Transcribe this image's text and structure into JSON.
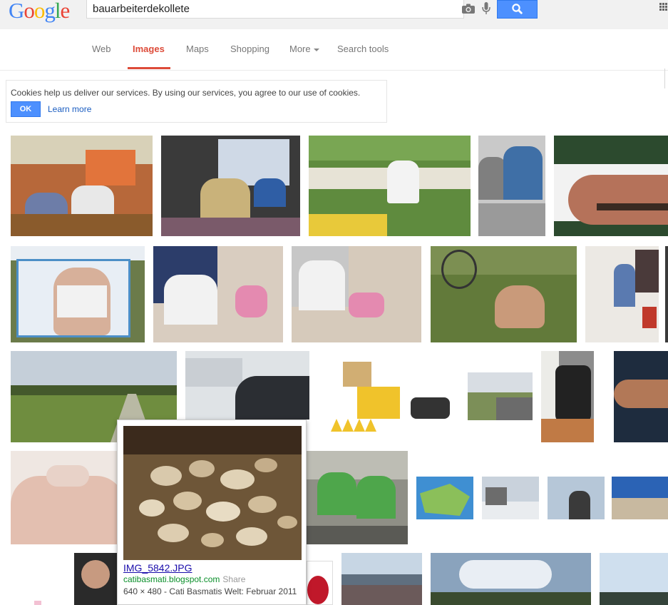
{
  "header": {
    "logo": {
      "l1": "G",
      "l2": "o",
      "l3": "o",
      "l4": "g",
      "l5": "l",
      "l6": "e"
    },
    "search_value": "bauarbeiterdekollete",
    "camera_icon": "camera-icon",
    "mic_icon": "microphone-icon",
    "search_icon": "magnifier-icon",
    "apps_icon": "apps-grid-icon"
  },
  "nav": {
    "tabs": [
      {
        "label": "Web"
      },
      {
        "label": "Images"
      },
      {
        "label": "Maps"
      },
      {
        "label": "Shopping"
      },
      {
        "label": "More"
      },
      {
        "label": "Search tools"
      }
    ],
    "active": "Images"
  },
  "cookie": {
    "text": "Cookies help us deliver our services. By using our services, you agree to our use of cookies.",
    "ok_label": "OK",
    "learn_more": "Learn more"
  },
  "hover_card": {
    "title": "IMG_5842.JPG",
    "source": "catibasmati.blogspot.com",
    "share": "Share",
    "description": "640 × 480 - Cati Basmatis Welt: Februar 2011"
  },
  "colors": {
    "accent_red": "#dd4b39",
    "search_blue": "#4d90fe",
    "link_blue": "#1a0dab",
    "url_green": "#0a8f2a"
  }
}
